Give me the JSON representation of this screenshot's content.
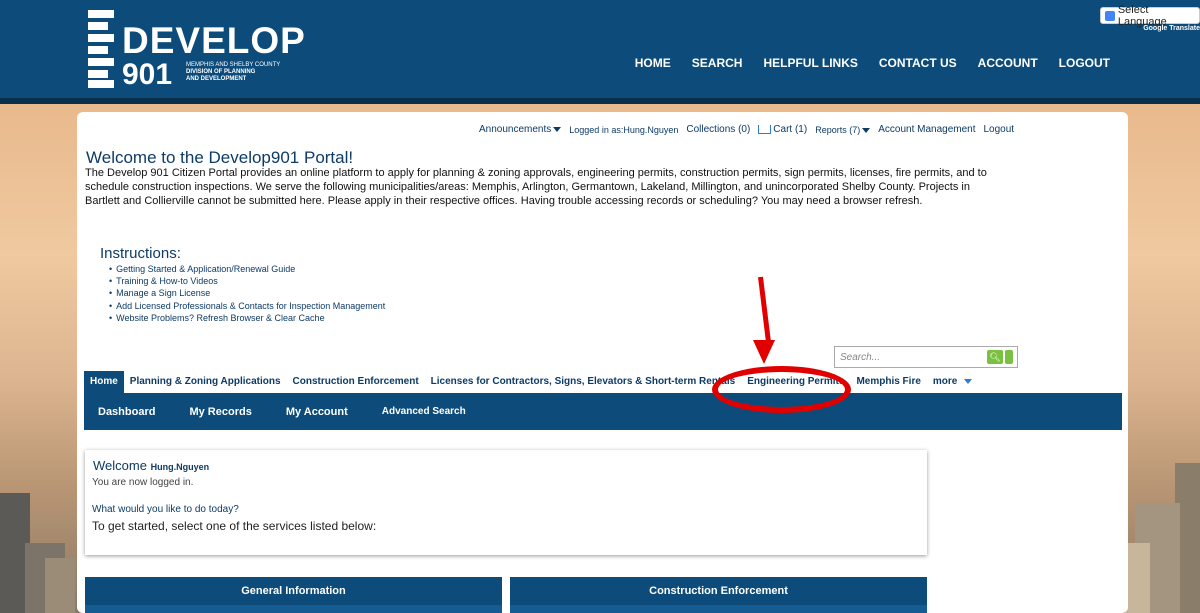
{
  "header": {
    "logo_word": "DEVELOP",
    "logo_num": "901",
    "logo_sub1": "MEMPHIS AND SHELBY COUNTY",
    "logo_sub2": "DIVISION OF PLANNING",
    "logo_sub3": "AND DEVELOPMENT",
    "nav": [
      "HOME",
      "SEARCH",
      "HELPFUL LINKS",
      "CONTACT US",
      "ACCOUNT",
      "LOGOUT"
    ],
    "translate_label": "Select Language",
    "powered_by": "Google Translate"
  },
  "util_bar": {
    "announcements": "Announcements",
    "logged_in": "Logged in as:Hung.Nguyen",
    "collections": "Collections (0)",
    "cart": "Cart (1)",
    "reports": "Reports (7)",
    "account_mgmt": "Account Management",
    "logout": "Logout"
  },
  "main": {
    "welcome_title": "Welcome to the Develop901 Portal!",
    "intro": "The Develop 901 Citizen Portal provides an online platform to apply for planning & zoning approvals, engineering permits, construction permits, sign permits, licenses, fire permits, and to schedule construction inspections. We serve the following municipalities/areas: Memphis, Arlington, Germantown, Lakeland, Millington, and unincorporated Shelby County. Projects in Bartlett and Collierville cannot be submitted here. Please apply in their respective offices. Having trouble accessing records or scheduling? You may need a browser refresh.",
    "instructions_title": "Instructions:",
    "instructions": [
      "Getting Started & Application/Renewal Guide",
      "Training & How-to Videos",
      "Manage a Sign License",
      "Add Licensed Professionals & Contacts for Inspection Management",
      "Website Problems? Refresh Browser & Clear Cache"
    ],
    "search_placeholder": "Search..."
  },
  "tabs": [
    "Home",
    "Planning & Zoning Applications",
    "Construction Enforcement",
    "Licenses for Contractors, Signs, Elevators & Short-term Rentals",
    "Engineering Permits",
    "Memphis Fire",
    "more"
  ],
  "subnav": [
    "Dashboard",
    "My Records",
    "My Account",
    "Advanced Search"
  ],
  "welcome_box": {
    "title": "Welcome",
    "user": "Hung.Nguyen",
    "logged": "You are now logged in.",
    "question": "What would you like to do today?",
    "started": "To get started, select one of the services listed below:"
  },
  "sections": [
    "General Information",
    "Construction Enforcement"
  ],
  "colors": {
    "header": "#0d4c7a",
    "annotation": "#e00000",
    "search_button": "#7ac142"
  }
}
